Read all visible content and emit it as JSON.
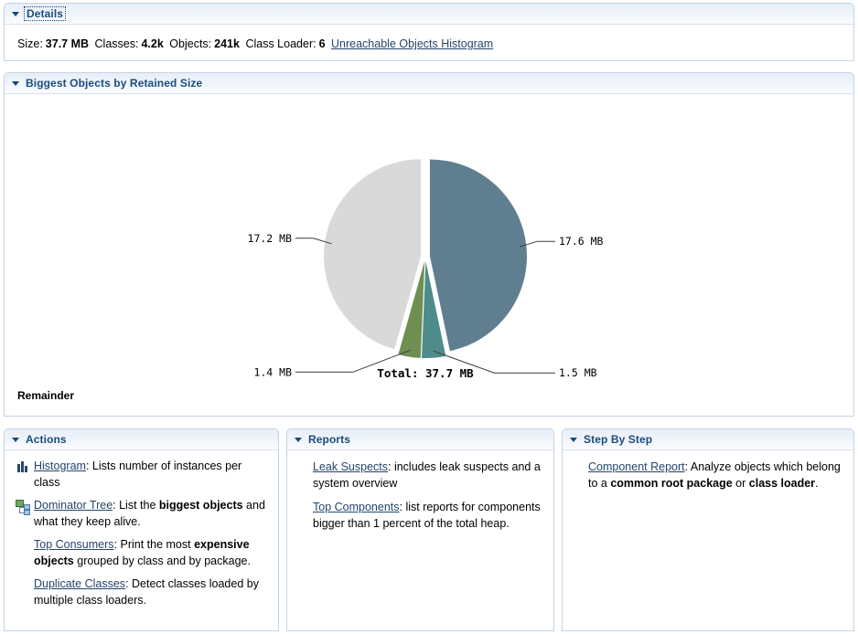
{
  "details": {
    "title": "Details",
    "size_label": "Size:",
    "size_value": "37.7 MB",
    "classes_label": "Classes:",
    "classes_value": "4.2k",
    "objects_label": "Objects:",
    "objects_value": "241k",
    "classloader_label": "Class Loader:",
    "classloader_value": "6",
    "unreachable_link": "Unreachable Objects Histogram"
  },
  "biggest": {
    "title": "Biggest Objects by Retained Size",
    "remainder_label": "Remainder"
  },
  "chart_data": {
    "type": "pie",
    "title": "Biggest Objects by Retained Size",
    "total_label": "Total: 37.7 MB",
    "total_value": 37.7,
    "unit": "MB",
    "labels": [
      "17.6 MB",
      "1.5 MB",
      "1.4 MB",
      "17.2 MB"
    ],
    "values": [
      17.6,
      1.5,
      1.4,
      17.2
    ],
    "colors": [
      "#5F7F90",
      "#4E8C8C",
      "#6E8F50",
      "#D9D9D9"
    ],
    "legend": "none",
    "exploded": true,
    "label_positions": [
      "top-right",
      "left",
      "left",
      "bottom-right"
    ]
  },
  "actions": {
    "title": "Actions",
    "items": [
      {
        "icon": "histogram-icon",
        "link": "Histogram",
        "text_before": "",
        "text_after": ": Lists number of instances per class",
        "bold_parts": []
      },
      {
        "icon": "dominator-tree-icon",
        "link": "Dominator Tree",
        "text_after": ": List the biggest objects and what they keep alive.",
        "bold_parts": [
          "biggest objects"
        ]
      },
      {
        "icon": "none",
        "link": "Top Consumers",
        "text_after": ": Print the most expensive objects grouped by class and by package.",
        "bold_parts": [
          "expensive objects"
        ]
      },
      {
        "icon": "none",
        "link": "Duplicate Classes",
        "text_after": ": Detect classes loaded by multiple class loaders.",
        "bold_parts": []
      }
    ]
  },
  "reports": {
    "title": "Reports",
    "items": [
      {
        "link": "Leak Suspects",
        "text_after": ": includes leak suspects and a system overview"
      },
      {
        "link": "Top Components",
        "text_after": ": list reports for components bigger than 1 percent of the total heap."
      }
    ]
  },
  "steps": {
    "title": "Step By Step",
    "items": [
      {
        "link": "Component Report",
        "text_after": ": Analyze objects which belong to a common root package or class loader.",
        "bold_parts": [
          "common root package",
          "class loader"
        ]
      }
    ]
  }
}
